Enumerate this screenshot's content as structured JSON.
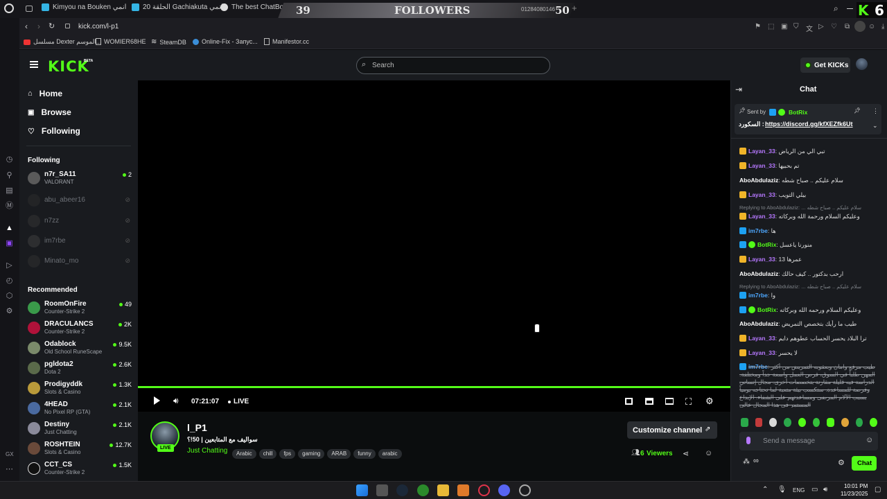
{
  "browser": {
    "tabs": [
      {
        "label": "Kimyou na Bouken انمي"
      },
      {
        "label": "20 الحلقة Gachiakuta انمي"
      },
      {
        "label": "The best ChatBot"
      }
    ],
    "overlay": {
      "left_num": "39",
      "title": "FOLLOWERS",
      "right_num": "50",
      "ticker": "01284080146"
    },
    "corner_badge": {
      "letter": "K",
      "num": "6"
    },
    "address": "kick.com/l-p1",
    "bookmarks": [
      {
        "label": "مسلسل Dexter الموسم..."
      },
      {
        "label": "WOMIER68HE"
      },
      {
        "label": "SteamDB"
      },
      {
        "label": "Online-Fix - Запус..."
      },
      {
        "label": "Manifestor.cc"
      }
    ],
    "side_label": "GX"
  },
  "header": {
    "logo": "KICK",
    "logo_sup": "BETA",
    "search_placeholder": "Search",
    "get_kicks": "Get KICKs"
  },
  "sidebar": {
    "nav": [
      {
        "label": "Home"
      },
      {
        "label": "Browse"
      },
      {
        "label": "Following"
      }
    ],
    "following_title": "Following",
    "following": [
      {
        "name": "n7r_SA11",
        "category": "VALORANT",
        "viewers": "2",
        "live": true
      },
      {
        "name": "abu_abeer16",
        "live": false
      },
      {
        "name": "n7zz",
        "live": false
      },
      {
        "name": "im7rbe",
        "live": false
      },
      {
        "name": "Minato_mo",
        "live": false
      }
    ],
    "recommended_title": "Recommended",
    "recommended": [
      {
        "name": "RoomOnFire",
        "category": "Counter-Strike 2",
        "viewers": "49"
      },
      {
        "name": "DRACULANCS",
        "category": "Counter-Strike 2",
        "viewers": "2K"
      },
      {
        "name": "Odablock",
        "category": "Old School RuneScape",
        "viewers": "9.5K"
      },
      {
        "name": "pgldota2",
        "category": "Dota 2",
        "viewers": "2.6K"
      },
      {
        "name": "Prodigyddk",
        "category": "Slots & Casino",
        "viewers": "1.3K"
      },
      {
        "name": "4HEAD",
        "category": "No Pixel RP (GTA)",
        "viewers": "2.1K"
      },
      {
        "name": "Destiny",
        "category": "Just Chatting",
        "viewers": "2.1K"
      },
      {
        "name": "ROSHTEIN",
        "category": "Slots & Casino",
        "viewers": "12.7K"
      },
      {
        "name": "CCT_CS",
        "category": "Counter-Strike 2",
        "viewers": "1.5K"
      }
    ]
  },
  "player": {
    "time": "07:21:07",
    "live": "LIVE"
  },
  "channel": {
    "name": "l_P1",
    "title": "سواليف مع المتابعين | 50!؟",
    "live_badge": "LIVE",
    "category": "Just Chatting",
    "tags": [
      "Arabic",
      "chill",
      "fps",
      "gaming",
      "ARAB",
      "funny",
      "arabic"
    ],
    "customize": "Customize channel",
    "viewers": "6",
    "viewers_label": "Viewers"
  },
  "chat": {
    "title": "Chat",
    "pinned": {
      "sent_by": "Sent by",
      "user": "BotRix",
      "prefix": "السكورد :",
      "link": "https://discord.gg/kfXEZfk6Ut"
    },
    "messages": [
      {
        "user": "Layan_33",
        "badge": "crown",
        "text": "تبي الي من الرياض"
      },
      {
        "user": "Layan_33",
        "badge": "crown",
        "text": "تم بحبيها"
      },
      {
        "user": "AboAbdulaziz",
        "badge": "",
        "text": "سلام عليكم .. صباح شطه"
      },
      {
        "user": "Layan_33",
        "badge": "crown",
        "text": "بيلي التويب"
      },
      {
        "reply": "Replying to AboAbdulaziz: ... سلام عليكم .. صباح شطه",
        "user": "Layan_33",
        "badge": "crown",
        "text": "وعليكم السلام ورحمة الله وبركاته"
      },
      {
        "user": "im7rbe",
        "badge": "bot",
        "text": "ها"
      },
      {
        "user": "BotRix",
        "badge": "bot",
        "text": "منورنا ياعسل"
      },
      {
        "user": "Layan_33",
        "badge": "crown",
        "text": "عمرها 13"
      },
      {
        "user": "AboAbdulaziz",
        "badge": "",
        "text": "ارحب بدكتور .. كيف حالك"
      },
      {
        "reply": "Replying to AboAbdulaziz: ... سلام عليكم .. صباح شطه",
        "user": "im7rbe",
        "badge": "bot",
        "text": "وا"
      },
      {
        "user": "BotRix",
        "badge": "bot",
        "text": "وعليكم السلام ورحمه الله وبركاته"
      },
      {
        "user": "AboAbdulaziz",
        "badge": "",
        "text": "طيب ما رأيك بتخصص التمريض"
      },
      {
        "user": "Layan_33",
        "badge": "crown",
        "text": "ترا البلاد يحسر الحساب عطوهم دايم"
      },
      {
        "user": "Layan_33",
        "badge": "crown",
        "text": "لا يحسر"
      },
      {
        "user": "im7rbe",
        "badge": "bot",
        "text": "طيب مرفع وامان وبعقوبه التمريض من أكثر المهن طلباً في السوق، فرص العمل واسعة جداً ومختلفة. الدراسة فيه قليلة مقارنة بتخصصات أخرى. مجال إنساني وفرصة للمساعدة. ستكسب بيئة متعبة لما تحتاجه يومياً بسبب الآلام المرضى ومساعدتهم على الشفاء. الإبداع المستمر في هذا المجال عالي"
      }
    ],
    "input_placeholder": "Send a message",
    "send": "Chat"
  },
  "taskbar": {
    "lang": "ENG",
    "time": "10:01 PM",
    "date": "11/23/2025"
  },
  "colors": {
    "accent": "#53fc18",
    "bg": "#0b0d0e",
    "panel": "#191b1f"
  }
}
